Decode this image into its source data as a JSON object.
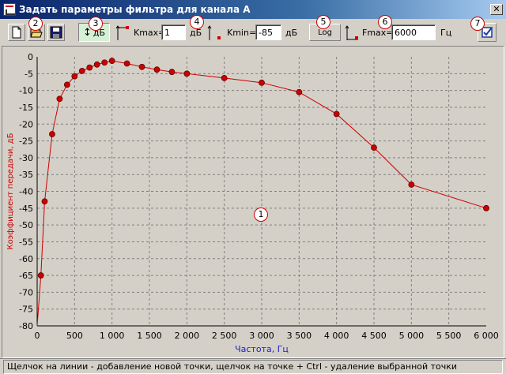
{
  "window": {
    "title": "Задать параметры фильтра для канала А",
    "close_label": "✕"
  },
  "toolbar": {
    "db_label": "дБ",
    "kmax_label": "Kmax=",
    "kmax_value": "1",
    "kmax_unit": "дБ",
    "kmin_label": "Kmin=",
    "kmin_value": "-85",
    "kmin_unit": "дБ",
    "log_label": "Log",
    "fmax_label": "Fmax=",
    "fmax_value": "6000",
    "fmax_unit": "Гц",
    "icons": [
      "new-file-icon",
      "open-folder-icon",
      "save-disk-icon",
      "apply-check-icon"
    ]
  },
  "markers": [
    "1",
    "2",
    "3",
    "4",
    "5",
    "6",
    "7"
  ],
  "chart_data": {
    "type": "line",
    "xlabel": "Частота, Гц",
    "ylabel": "Коэффициент передачи, дБ",
    "xlim": [
      0,
      6000
    ],
    "ylim": [
      -85,
      1
    ],
    "x_ticks": [
      "0",
      "500",
      "1 000",
      "1 500",
      "2 000",
      "2 500",
      "3 000",
      "3 500",
      "4 000",
      "4 500",
      "5 000",
      "5 500",
      "6 000"
    ],
    "y_ticks": [
      "0",
      "-5",
      "-10",
      "-15",
      "-20",
      "-25",
      "-30",
      "-35",
      "-40",
      "-45",
      "-50",
      "-55",
      "-60",
      "-65",
      "-70",
      "-75",
      "-80"
    ],
    "grid": true,
    "line_color": "#cc0000",
    "points": [
      {
        "x": 0,
        "y": -85
      },
      {
        "x": 50,
        "y": -65
      },
      {
        "x": 100,
        "y": -43
      },
      {
        "x": 200,
        "y": -23
      },
      {
        "x": 300,
        "y": -12.5
      },
      {
        "x": 400,
        "y": -8.3
      },
      {
        "x": 500,
        "y": -5.8
      },
      {
        "x": 600,
        "y": -4.2
      },
      {
        "x": 700,
        "y": -3.2
      },
      {
        "x": 800,
        "y": -2.3
      },
      {
        "x": 900,
        "y": -1.7
      },
      {
        "x": 1000,
        "y": -1.2
      },
      {
        "x": 1200,
        "y": -2.0
      },
      {
        "x": 1400,
        "y": -3.0
      },
      {
        "x": 1600,
        "y": -3.8
      },
      {
        "x": 1800,
        "y": -4.5
      },
      {
        "x": 2000,
        "y": -5.0
      },
      {
        "x": 2500,
        "y": -6.3
      },
      {
        "x": 3000,
        "y": -7.7
      },
      {
        "x": 3500,
        "y": -10.5
      },
      {
        "x": 4000,
        "y": -17
      },
      {
        "x": 4500,
        "y": -27
      },
      {
        "x": 5000,
        "y": -38
      },
      {
        "x": 6000,
        "y": -45
      }
    ]
  },
  "status": {
    "text": "Щелчок на линии - добавление новой точки, щелчок на точке + Ctrl - удаление выбранной точки"
  }
}
